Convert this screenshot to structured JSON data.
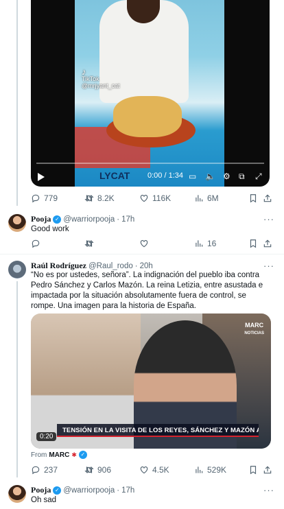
{
  "tweet1": {
    "video": {
      "watermark_app": "TikTok",
      "watermark_handle": "@mrjyant_cat",
      "brand_text": "LYCAT",
      "time": "0:00 / 1:34"
    },
    "stats": {
      "replies": "779",
      "retweets": "8.2K",
      "likes": "116K",
      "views": "6M"
    }
  },
  "reply1": {
    "name": "Pooja",
    "handle": "@warriorpooja",
    "sep": "·",
    "time": "17h",
    "text": "Good work",
    "stats": {
      "replies": "",
      "retweets": "",
      "likes": "",
      "views": "16"
    }
  },
  "tweet2": {
    "name": "Raúl Rodríguez",
    "handle": "@Raul_rodo",
    "sep": "·",
    "time": "20h",
    "text": "“No es por ustedes, señora”. La indignación del pueblo iba contra Pedro Sánchez y Carlos Mazón. La reina Letizia, entre asustada e impactada por la situación absolutamente fuera de control, se rompe. Una imagen para la historia de España.",
    "video": {
      "banner": "TENSIÓN EN LA VISITA DE LOS REYES, SÁNCHEZ Y MAZÓN A PAIPORTA",
      "duration": "0:20",
      "logo": "MARC",
      "logo_sub": "NOTICIAS"
    },
    "from_label": "From",
    "from_source": "MARC",
    "stats": {
      "replies": "237",
      "retweets": "906",
      "likes": "4.5K",
      "views": "529K"
    }
  },
  "reply2": {
    "name": "Pooja",
    "handle": "@warriorpooja",
    "sep": "·",
    "time": "17h",
    "text": "Oh sad"
  },
  "icons": {
    "reply": "reply-icon",
    "retweet": "retweet-icon",
    "like": "heart-icon",
    "views": "views-icon",
    "bookmark": "bookmark-icon",
    "share": "share-icon"
  },
  "colors": {
    "accent": "#1d9bf0",
    "secondary_text": "#536471",
    "text": "#0f1419"
  }
}
